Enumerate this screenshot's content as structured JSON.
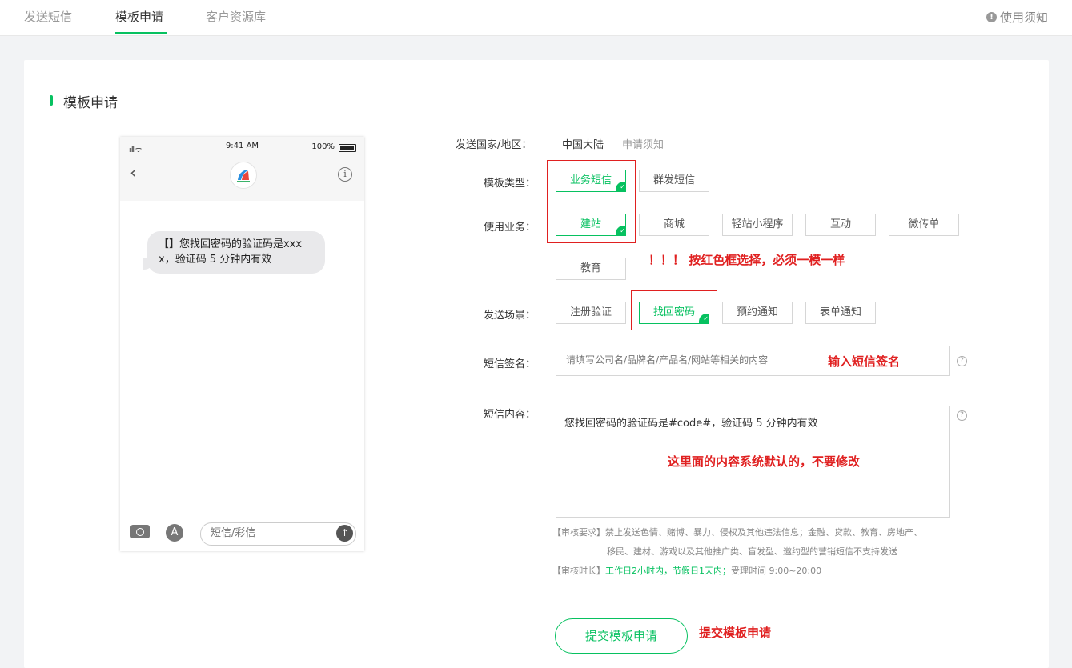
{
  "nav": {
    "tabs": [
      {
        "label": "发送短信"
      },
      {
        "label": "模板申请"
      },
      {
        "label": "客户资源库"
      }
    ],
    "notice_label": "使用须知"
  },
  "section_title": "模板申请",
  "phone": {
    "status_time": "9:41 AM",
    "battery": "100%",
    "signal": "ııll ᯤ",
    "bubble_text": "【】您找回密码的验证码是xxxx，验证码 5 分钟内有效",
    "input_placeholder": "短信/彩信",
    "back_icon": "‹",
    "info_icon": "i",
    "send_icon": "↑",
    "appstore_icon": "A"
  },
  "form": {
    "country_label": "发送国家/地区：",
    "country_value": "中国大陆",
    "apply_notice": "申请须知",
    "template_type_label": "模板类型：",
    "template_types": [
      "业务短信",
      "群发短信"
    ],
    "business_label": "使用业务：",
    "businesses": [
      "建站",
      "商城",
      "轻站小程序",
      "互动",
      "微传单",
      "教育"
    ],
    "scene_label": "发送场景：",
    "scenes": [
      "注册验证",
      "找回密码",
      "预约通知",
      "表单通知"
    ],
    "signature_label": "短信签名：",
    "signature_placeholder": "请填写公司名/品牌名/产品名/网站等相关的内容",
    "content_label": "短信内容：",
    "content_value": "您找回密码的验证码是#code#，验证码 5 分钟内有效",
    "review_req_tag": "【审核要求】",
    "review_req_text_1": "禁止发送色情、赌博、暴力、侵权及其他违法信息；金融、贷款、教育、房地产、",
    "review_req_text_2": "移民、建材、游戏以及其他推广类、盲发型、邀约型的营销短信不支持发送",
    "review_time_tag": "【审核时长】",
    "review_time_green": "工作日2小时内，节假日1天内；",
    "review_time_rest": "受理时间 9:00~20:00",
    "submit_label": "提交模板申请",
    "help_icon": "?"
  },
  "annotations": {
    "select_red": "！！！ 按红色框选择，必须一模一样",
    "enter_signature": "输入短信签名",
    "content_default": "这里面的内容系统默认的，不要修改",
    "submit_hint": "提交模板申请"
  },
  "colors": {
    "accent": "#07c160",
    "annotation": "#e02020"
  }
}
